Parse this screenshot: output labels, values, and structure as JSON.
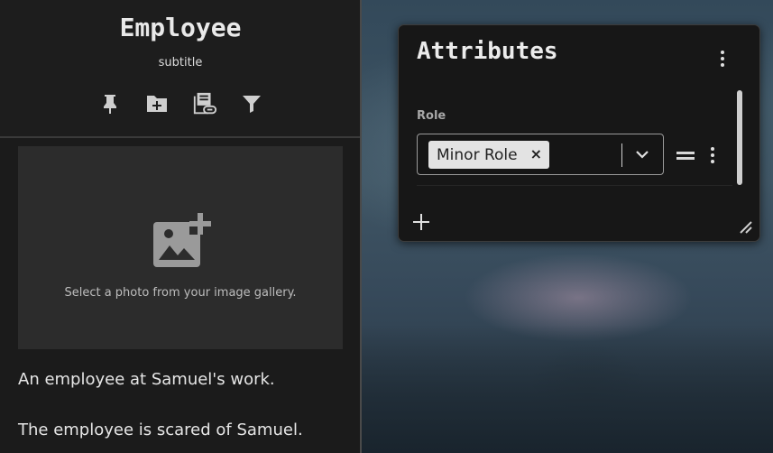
{
  "sheet": {
    "title": "Employee",
    "subtitle": "subtitle",
    "toolbar": [
      {
        "icon": "pin-icon"
      },
      {
        "icon": "folder-add-icon"
      },
      {
        "icon": "library-link-icon"
      },
      {
        "icon": "filter-icon"
      }
    ],
    "photo_prompt": "Select a photo from your image gallery.",
    "description": [
      "An employee at Samuel's work.",
      "The employee is scared of Samuel."
    ]
  },
  "attributes": {
    "title": "Attributes",
    "field_label": "Role",
    "selected_value": "Minor Role",
    "remove_glyph": "×"
  },
  "colors": {
    "panel_bg": "#1b1b1b",
    "window_bg": "#171717",
    "chip_bg": "#e3e3e3",
    "text": "#e6e6e6"
  }
}
